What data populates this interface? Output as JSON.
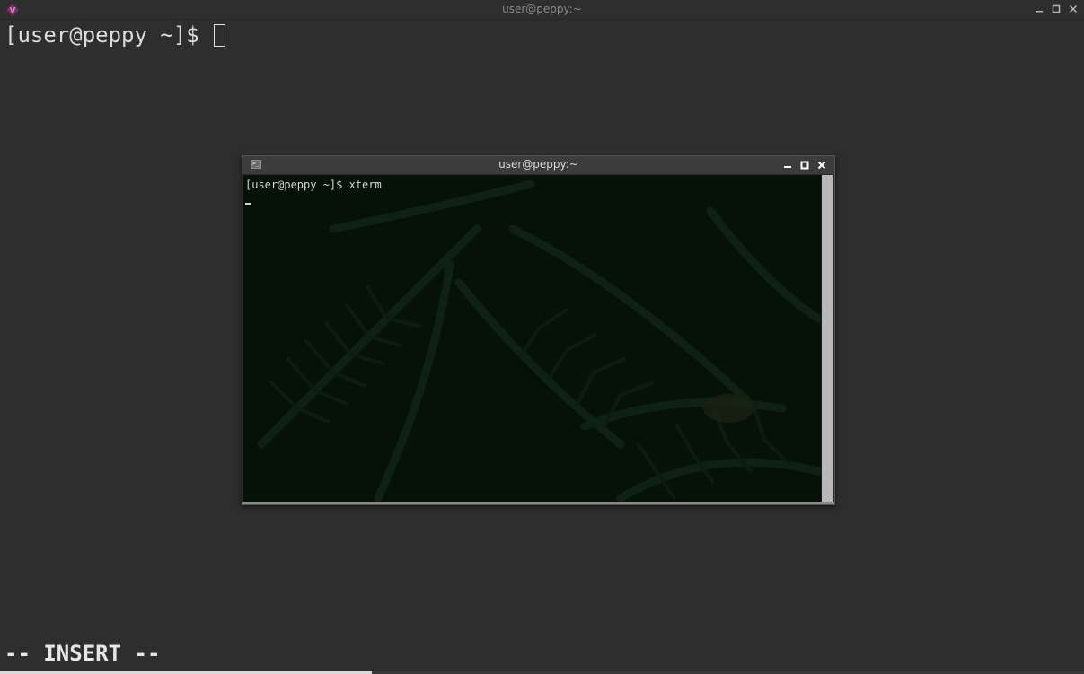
{
  "outer_window": {
    "title": "user@peppy:~",
    "prompt": "[user@peppy ~]$ ",
    "status_line": "-- INSERT --"
  },
  "xterm_window": {
    "title": "user@peppy:~",
    "line1": "[user@peppy ~]$ xterm"
  },
  "icons": {
    "outer_app": "vim-icon",
    "xterm_app": "terminal-icon",
    "minimize": "minimize-icon",
    "maximize": "maximize-icon",
    "close": "close-icon"
  },
  "colors": {
    "background": "#2e2e2e",
    "xterm_background": "#061208",
    "text": "#dcdcdc"
  }
}
